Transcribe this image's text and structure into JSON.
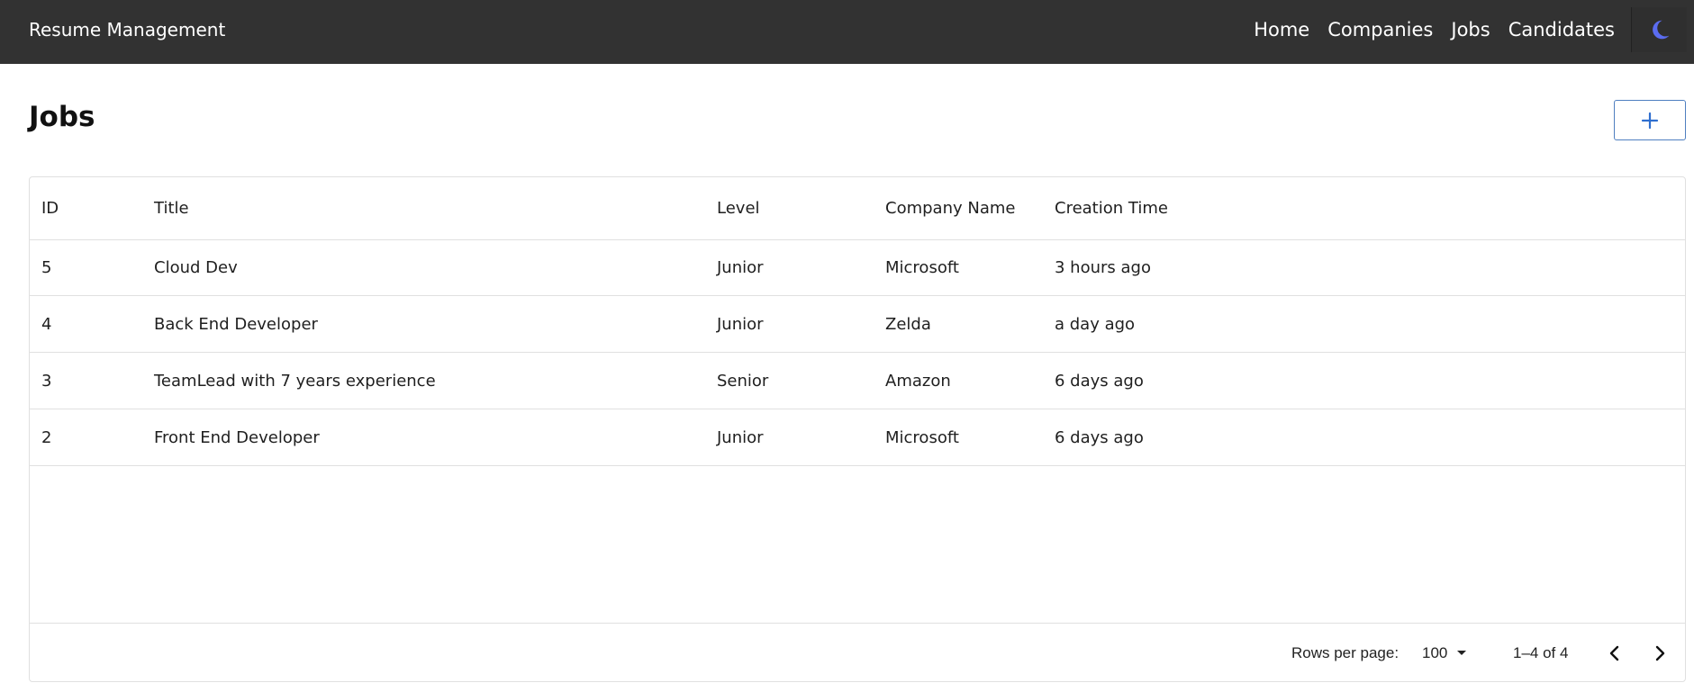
{
  "app": {
    "title": "Resume Management"
  },
  "nav": {
    "items": [
      {
        "label": "Home"
      },
      {
        "label": "Companies"
      },
      {
        "label": "Jobs"
      },
      {
        "label": "Candidates"
      }
    ],
    "theme_icon": "moon-icon"
  },
  "page": {
    "title": "Jobs",
    "add_icon": "plus-icon"
  },
  "table": {
    "columns": [
      "ID",
      "Title",
      "Level",
      "Company Name",
      "Creation Time"
    ],
    "rows": [
      [
        "5",
        "Cloud Dev",
        "Junior",
        "Microsoft",
        "3 hours ago"
      ],
      [
        "4",
        "Back End Developer",
        "Junior",
        "Zelda",
        "a day ago"
      ],
      [
        "3",
        "TeamLead with 7 years experience",
        "Senior",
        "Amazon",
        "6 days ago"
      ],
      [
        "2",
        "Front End Developer",
        "Junior",
        "Microsoft",
        "6 days ago"
      ]
    ]
  },
  "pagination": {
    "rows_per_page_label": "Rows per page:",
    "rows_per_page_value": "100",
    "range_text": "1–4 of 4",
    "prev_icon": "chevron-left-icon",
    "next_icon": "chevron-right-icon"
  },
  "colors": {
    "topbar": "#323232",
    "accent": "#2f6fcf",
    "moon": "#5b6cf0"
  }
}
